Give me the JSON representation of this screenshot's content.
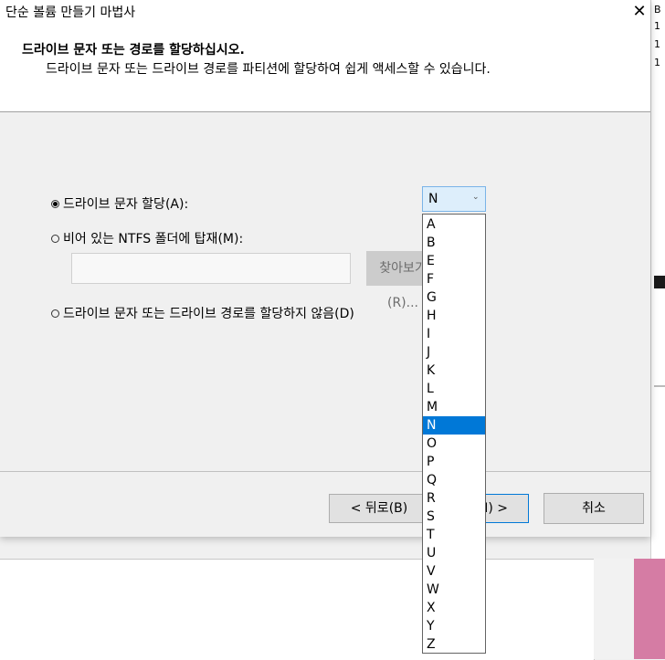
{
  "background": {
    "right_edge_chars": [
      "B",
      "1",
      "1",
      "1"
    ]
  },
  "window": {
    "title": "단순 볼륨 만들기 마법사",
    "close_glyph": "✕"
  },
  "header": {
    "title": "드라이브 문자 또는 경로를 할당하십시오.",
    "subtitle": "드라이브 문자 또는 드라이브 경로를 파티션에 할당하여 쉽게 액세스할 수 있습니다."
  },
  "options": {
    "assign_letter": {
      "label": "드라이브 문자 할당(A):",
      "selected": true
    },
    "mount_folder": {
      "label": "비어 있는 NTFS 폴더에 탑재(M):",
      "selected": false
    },
    "browse_label": "찾아보기(R)...",
    "folder_value": "",
    "no_letter": {
      "label": "드라이브 문자 또는 드라이브 경로를 할당하지 않음(D)",
      "selected": false
    }
  },
  "drive_combo": {
    "selected": "N",
    "arrow_glyph": "⌄"
  },
  "drive_list": [
    "A",
    "B",
    "E",
    "F",
    "G",
    "H",
    "I",
    "J",
    "K",
    "L",
    "M",
    "N",
    "O",
    "P",
    "Q",
    "R",
    "S",
    "T",
    "U",
    "V",
    "W",
    "X",
    "Y",
    "Z"
  ],
  "buttons": {
    "back": "< 뒤로(B)",
    "next": "다음(N) >",
    "cancel": "취소"
  },
  "colors": {
    "selection": "#0078d7",
    "accent_pink": "#d57ca4"
  }
}
